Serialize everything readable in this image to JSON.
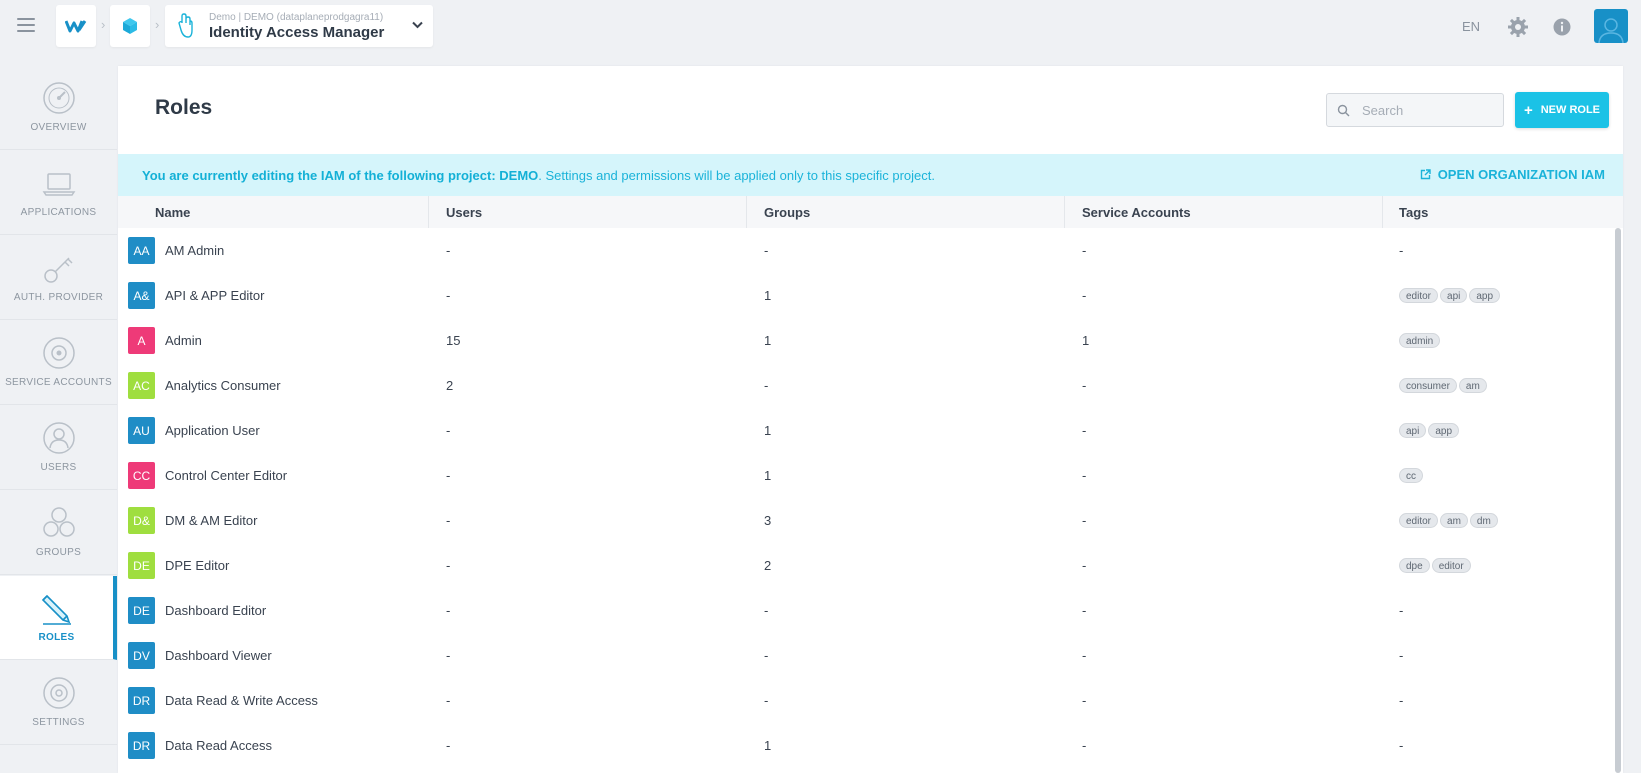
{
  "header": {
    "app_subtitle": "Demo | DEMO (dataplaneprodgagra11)",
    "app_title": "Identity Access Manager",
    "language": "EN"
  },
  "sidebar": {
    "items": [
      {
        "label": "OVERVIEW",
        "icon": "overview-icon"
      },
      {
        "label": "APPLICATIONS",
        "icon": "laptop-icon"
      },
      {
        "label": "AUTH. PROVIDER",
        "icon": "key-icon"
      },
      {
        "label": "SERVICE ACCOUNTS",
        "icon": "service-accounts-icon"
      },
      {
        "label": "USERS",
        "icon": "user-icon"
      },
      {
        "label": "GROUPS",
        "icon": "groups-icon"
      },
      {
        "label": "ROLES",
        "icon": "pencil-icon",
        "active": true
      },
      {
        "label": "SETTINGS",
        "icon": "gear-icon"
      }
    ]
  },
  "main": {
    "title": "Roles",
    "search_placeholder": "Search",
    "new_role_label": "NEW ROLE",
    "banner_strong": "You are currently editing the IAM of the following project: DEMO",
    "banner_rest": ". Settings and permissions will be applied only to this specific project.",
    "banner_link": "OPEN ORGANIZATION IAM"
  },
  "table": {
    "columns": [
      "Name",
      "Users",
      "Groups",
      "Service Accounts",
      "Tags"
    ],
    "rows": [
      {
        "initials": "AA",
        "color": "#1f8dc6",
        "name": "AM Admin",
        "users": "-",
        "groups": "-",
        "sa": "-",
        "tags": [],
        "tags_text": "-"
      },
      {
        "initials": "A&",
        "color": "#1f8dc6",
        "name": "API & APP Editor",
        "users": "-",
        "groups": "1",
        "sa": "-",
        "tags": [
          "editor",
          "api",
          "app"
        ]
      },
      {
        "initials": "A",
        "color": "#ee3a78",
        "name": "Admin",
        "users": "15",
        "groups": "1",
        "sa": "1",
        "tags": [
          "admin"
        ]
      },
      {
        "initials": "AC",
        "color": "#9fde3f",
        "name": "Analytics Consumer",
        "users": "2",
        "groups": "-",
        "sa": "-",
        "tags": [
          "consumer",
          "am"
        ]
      },
      {
        "initials": "AU",
        "color": "#1f8dc6",
        "name": "Application User",
        "users": "-",
        "groups": "1",
        "sa": "-",
        "tags": [
          "api",
          "app"
        ]
      },
      {
        "initials": "CC",
        "color": "#ee3a78",
        "name": "Control Center Editor",
        "users": "-",
        "groups": "1",
        "sa": "-",
        "tags": [
          "cc"
        ]
      },
      {
        "initials": "D&",
        "color": "#9fde3f",
        "name": "DM & AM Editor",
        "users": "-",
        "groups": "3",
        "sa": "-",
        "tags": [
          "editor",
          "am",
          "dm"
        ]
      },
      {
        "initials": "DE",
        "color": "#9fde3f",
        "name": "DPE Editor",
        "users": "-",
        "groups": "2",
        "sa": "-",
        "tags": [
          "dpe",
          "editor"
        ]
      },
      {
        "initials": "DE",
        "color": "#1f8dc6",
        "name": "Dashboard Editor",
        "users": "-",
        "groups": "-",
        "sa": "-",
        "tags": [],
        "tags_text": "-"
      },
      {
        "initials": "DV",
        "color": "#1f8dc6",
        "name": "Dashboard Viewer",
        "users": "-",
        "groups": "-",
        "sa": "-",
        "tags": [],
        "tags_text": "-"
      },
      {
        "initials": "DR",
        "color": "#1f8dc6",
        "name": "Data Read & Write Access",
        "users": "-",
        "groups": "-",
        "sa": "-",
        "tags": [],
        "tags_text": "-"
      },
      {
        "initials": "DR",
        "color": "#1f8dc6",
        "name": "Data Read Access",
        "users": "-",
        "groups": "1",
        "sa": "-",
        "tags": [],
        "tags_text": "-"
      }
    ]
  }
}
